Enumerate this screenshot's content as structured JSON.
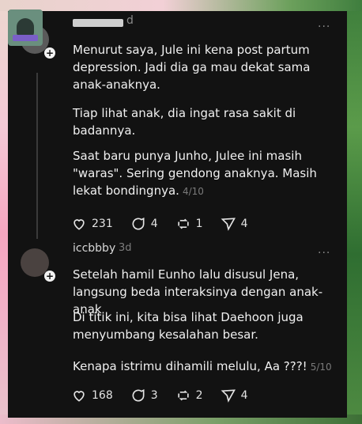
{
  "posts": [
    {
      "username": "d",
      "timestamp": "",
      "more": "···",
      "paragraphs": [
        "Menurut saya, Jule ini kena post partum depression. Jadi dia ga mau dekat sama anak-anaknya.",
        "Tiap lihat anak, dia ingat rasa sakit di badannya.",
        "Saat baru punya Junho, Julee ini masih \"waras\". Sering gendong anaknya. Masih lekat bondingnya."
      ],
      "page": "4/10",
      "likes": "231",
      "replies": "4",
      "reposts": "1",
      "shares": "4"
    },
    {
      "username": "iccbbby",
      "timestamp": "3d",
      "more": "···",
      "paragraphs": [
        "Setelah hamil Eunho lalu disusul Jena, langsung beda interaksinya dengan anak-anak",
        "Di titik ini, kita bisa lihat Daehoon juga menyumbang kesalahan besar.",
        "Kenapa istrimu dihamili melulu, Aa ???!"
      ],
      "page": "5/10",
      "likes": "168",
      "replies": "3",
      "reposts": "2",
      "shares": "4"
    }
  ],
  "icons": [
    "heart-icon",
    "comment-icon",
    "repost-icon",
    "share-icon",
    "plus-icon",
    "more-icon"
  ],
  "colors": {
    "panel": "#121212",
    "text": "#f0f0f0",
    "muted": "#7d7d7d"
  }
}
